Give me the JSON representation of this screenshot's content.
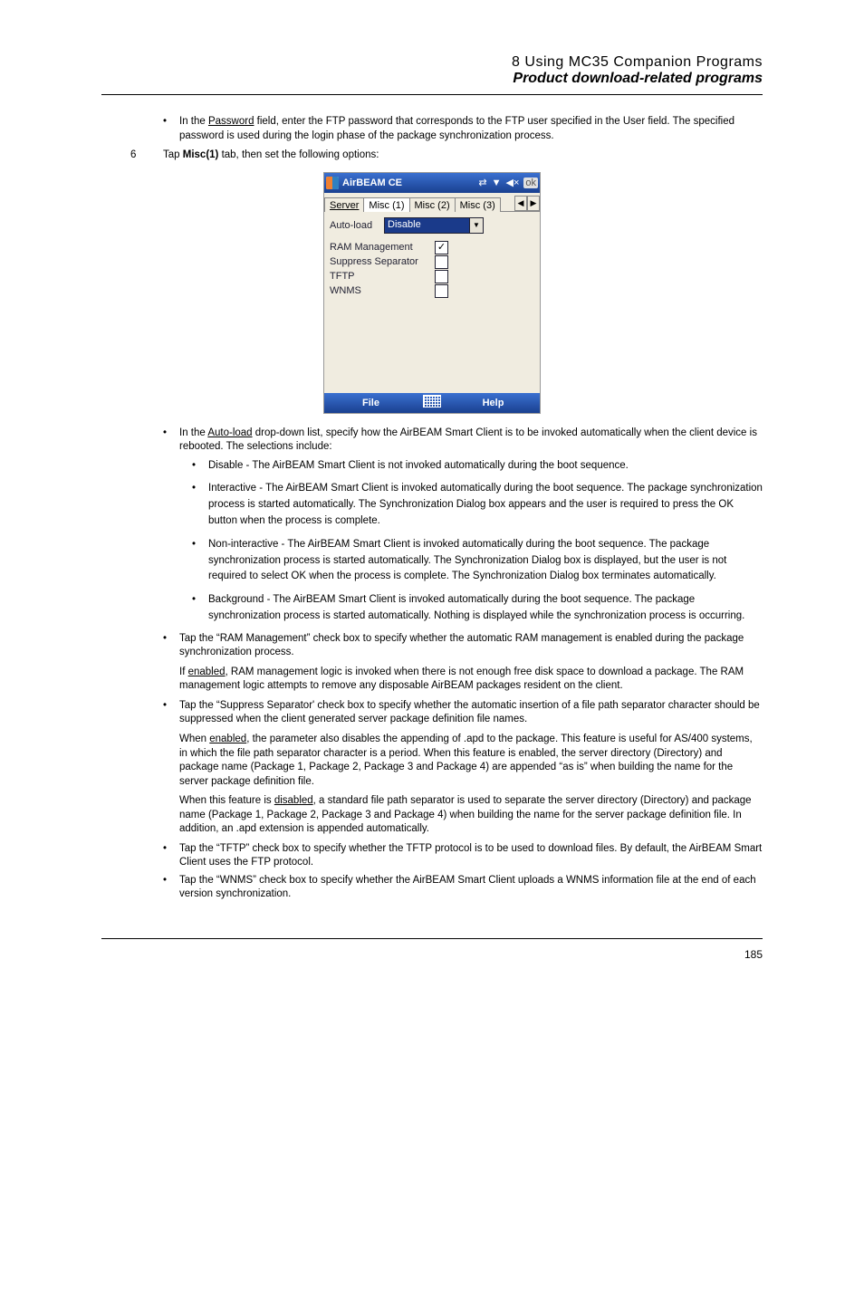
{
  "header": {
    "line1": "8 Using MC35 Companion Programs",
    "line2": "Product download-related programs"
  },
  "top_bullet": {
    "p1": "In the ",
    "u1": "Password",
    "p2": " field, enter the FTP password that corresponds to the FTP user specified in the User field. The specified password is used during the login phase of the package synchronization process."
  },
  "step": {
    "num": "6",
    "p1": "Tap ",
    "b1": "Misc(1)",
    "p2": " tab, then set the following options:"
  },
  "screenshot": {
    "title": "AirBEAM CE",
    "ok": "ok",
    "tabs": [
      "Server",
      "Misc (1)",
      "Misc (2)",
      "Misc (3)"
    ],
    "auto_load_label": "Auto-load",
    "auto_load_value": "Disable",
    "checks": [
      {
        "label": "RAM Management",
        "checked": true
      },
      {
        "label": "Suppress Separator",
        "checked": false
      },
      {
        "label": "TFTP",
        "checked": false
      },
      {
        "label": "WNMS",
        "checked": false
      }
    ],
    "bottom": {
      "file": "File",
      "help": "Help"
    }
  },
  "body": {
    "autoload_intro": {
      "p1": "In the ",
      "u1": "Auto-load",
      "p2": " drop-down list, specify how the AirBEAM Smart Client is to be invoked automatically when the client device is rebooted. The selections include:"
    },
    "opts": [
      "Disable - The AirBEAM Smart Client is not invoked automatically during the boot sequence.",
      "Interactive - The AirBEAM Smart Client is invoked automatically during the boot sequence. The package synchronization process is started automatically. The Synchronization Dialog box appears and the user is required to press the OK button when the process is complete.",
      "Non-interactive - The AirBEAM Smart Client is invoked automatically during the boot sequence. The package synchronization process is started automatically. The Synchronization Dialog box is displayed, but the user is not required to select OK when the process is complete. The Synchronization Dialog box terminates automatically.",
      "Background - The AirBEAM Smart Client is invoked automatically during the boot sequence. The package synchronization process is started automatically. Nothing is displayed while the synchronization process is occurring."
    ],
    "ram": "Tap the “RAM Management” check box to specify whether the automatic RAM management is enabled during the package synchronization process.",
    "ram_note": {
      "p1": "If ",
      "u1": "enabled",
      "p2": ", RAM management logic is invoked when there is not enough free disk space to download a package. The RAM management logic attempts to remove any disposable AirBEAM packages resident on the client."
    },
    "sep": "Tap the “Suppress Separator' check box to specify whether the automatic insertion of a file path separator character should be suppressed when the client generated server package definition file names.",
    "sep_enabled": {
      "p1": "When ",
      "u1": "enabled",
      "p2": ", the parameter also disables the appending of .apd to the package. This feature is useful for AS/400 systems, in which the file path separator character is a period. When this feature is enabled, the server directory (Directory) and package name (Package 1, Package 2, Package 3 and Package 4) are appended “as is” when building the name for the server package definition file."
    },
    "sep_disabled": {
      "p1": "When this feature is ",
      "u1": "disabled",
      "p2": ", a standard file path separator is used to separate the server directory (Directory) and package name (Package 1, Package 2, Package 3 and Package 4) when building the name for the server package definition file. In addition, an .apd extension is appended automatically."
    },
    "tftp": "Tap the “TFTP” check box to specify whether the TFTP protocol is to be used to download files. By default, the AirBEAM Smart Client uses the FTP protocol.",
    "wnms": "Tap the “WNMS” check box to specify whether the AirBEAM Smart Client uploads a WNMS information file at the end of each version synchronization."
  },
  "footer": {
    "page": "185"
  }
}
